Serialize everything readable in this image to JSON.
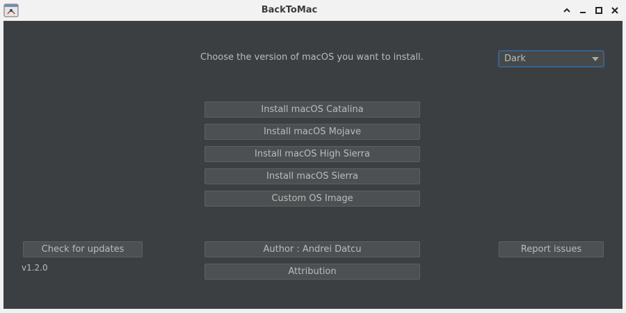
{
  "window": {
    "title": "BackToMac",
    "controls": {
      "collapse": "shade",
      "minimize": "minimize",
      "maximize": "maximize",
      "close": "close"
    }
  },
  "main": {
    "prompt": "Choose the version of macOS you want to install.",
    "theme_select": {
      "value": "Dark"
    },
    "install_buttons": [
      "Install macOS Catalina",
      "Install macOS Mojave",
      "Install macOS High Sierra",
      "Install macOS Sierra",
      "Custom OS Image"
    ]
  },
  "footer": {
    "check_updates": "Check for updates",
    "version": "v1.2.0",
    "author": "Author : Andrei Datcu",
    "attribution": "Attribution",
    "report_issues": "Report issues"
  },
  "colors": {
    "background": "#3c3f41",
    "button": "#4c5052",
    "text": "#bbbbbb",
    "focus_border": "#3d6185"
  },
  "icons": {
    "app": "java-app-icon",
    "collapse": "chevron-up-icon",
    "minimize": "minimize-icon",
    "maximize": "maximize-icon",
    "close": "close-icon"
  }
}
